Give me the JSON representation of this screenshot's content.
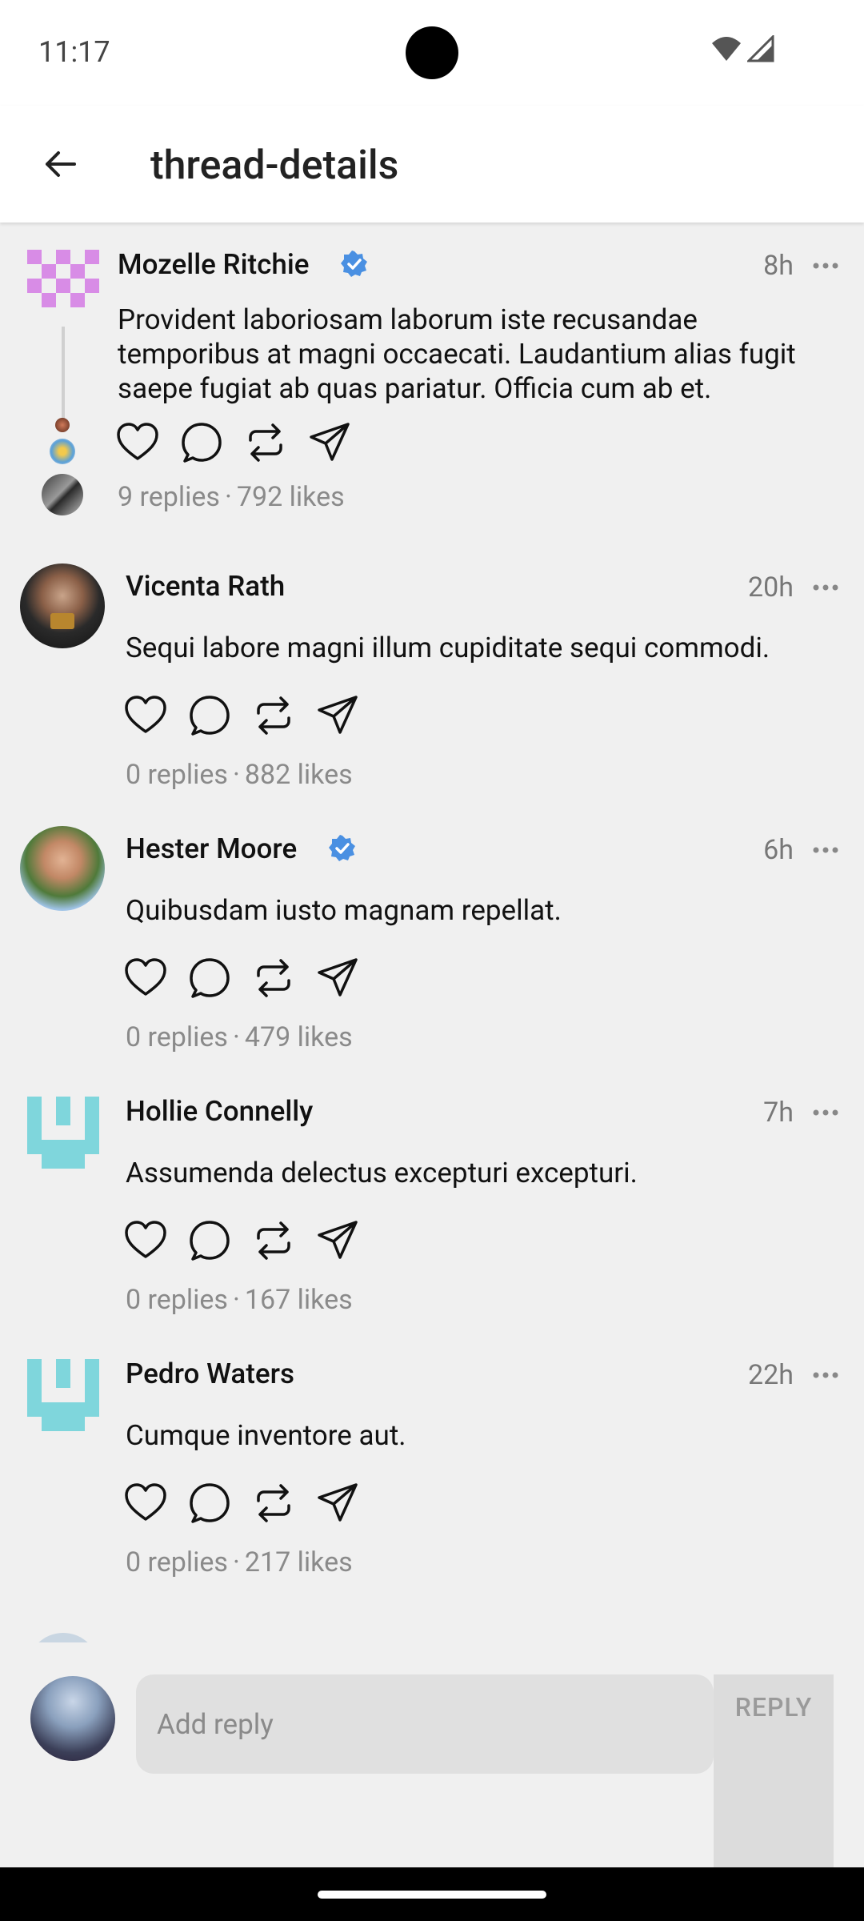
{
  "status_bar": {
    "time": "11:17"
  },
  "app_bar": {
    "title": "thread-details"
  },
  "posts": [
    {
      "author": "Mozelle Ritchie",
      "verified": true,
      "time": "8h",
      "text": "Provident laboriosam laborum iste recusandae temporibus at magni occaecati. Laudantium alias fugit saepe fugiat ab quas pariatur. Officia cum ab et.",
      "replies": "9 replies",
      "likes": "792 likes"
    },
    {
      "author": "Vicenta Rath",
      "verified": false,
      "time": "20h",
      "text": "Sequi labore magni illum cupiditate sequi commodi.",
      "replies": "0 replies",
      "likes": "882 likes"
    },
    {
      "author": "Hester Moore",
      "verified": true,
      "time": "6h",
      "text": "Quibusdam iusto magnam repellat.",
      "replies": "0 replies",
      "likes": "479 likes"
    },
    {
      "author": "Hollie Connelly",
      "verified": false,
      "time": "7h",
      "text": "Assumenda delectus excepturi excepturi.",
      "replies": "0 replies",
      "likes": "167 likes"
    },
    {
      "author": "Pedro Waters",
      "verified": false,
      "time": "22h",
      "text": "Cumque inventore aut.",
      "replies": "0 replies",
      "likes": "217 likes"
    }
  ],
  "meta_separator": "·",
  "reply_bar": {
    "placeholder": "Add reply",
    "button_label": "REPLY"
  },
  "colors": {
    "verified": "#4a90e2",
    "identicon_pink": "#d88ce6",
    "identicon_cyan": "#7fd6dc"
  },
  "icons": [
    "back-arrow-icon",
    "heart-icon",
    "comment-icon",
    "repost-icon",
    "send-icon",
    "more-icon",
    "verified-icon",
    "wifi-icon",
    "signal-icon"
  ]
}
